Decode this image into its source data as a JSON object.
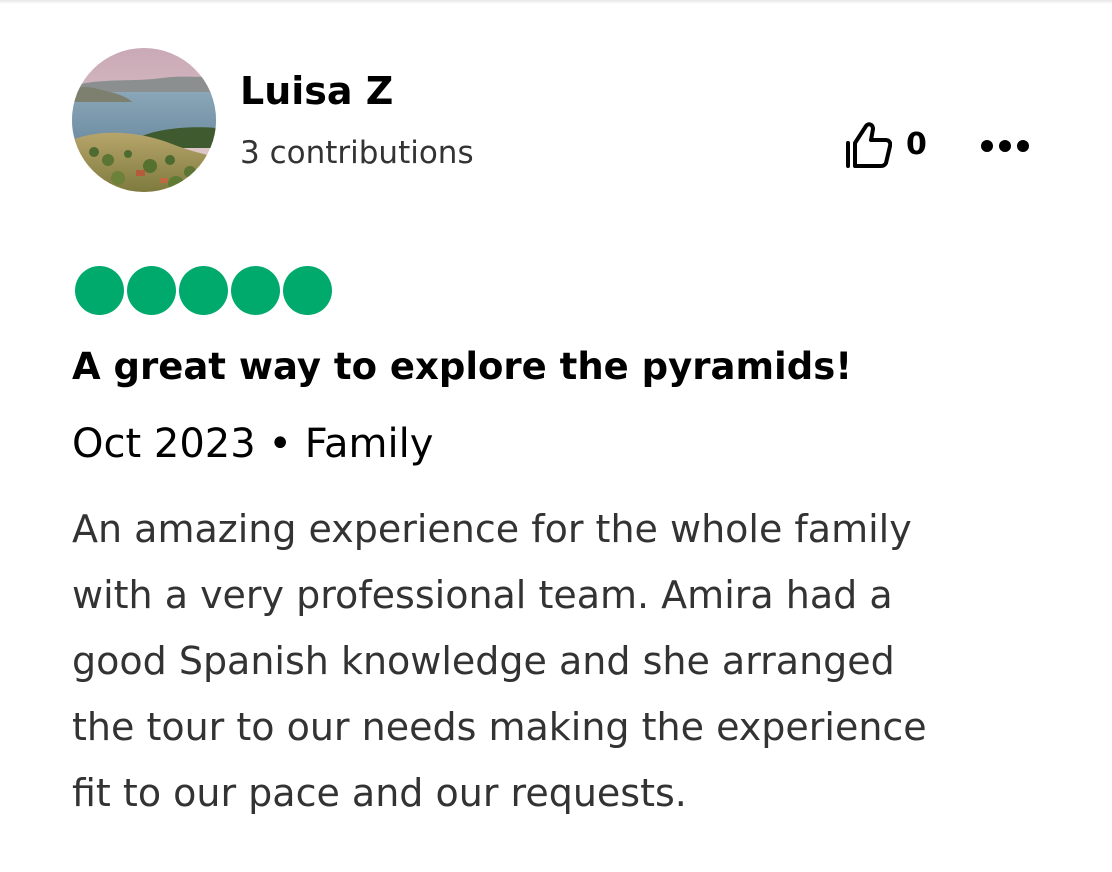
{
  "review": {
    "author": {
      "name": "Luisa Z",
      "contributions": "3 contributions",
      "avatar_icon": "landscape-avatar-photo"
    },
    "helpful": {
      "icon": "thumbs-up-icon",
      "count": "0"
    },
    "more_icon": "more-options-icon",
    "rating": {
      "bubbles": 5,
      "max": 5,
      "color": "#00aa6c"
    },
    "title": "A great way to explore the pyramids!",
    "meta": "Oct 2023 • Family",
    "body_lines": [
      "An amazing experience for the whole family",
      "with a very professional team. Amira had a",
      "good Spanish knowledge and she arranged",
      "the tour to our needs making the experience",
      "fit to our pace and our requests."
    ]
  }
}
